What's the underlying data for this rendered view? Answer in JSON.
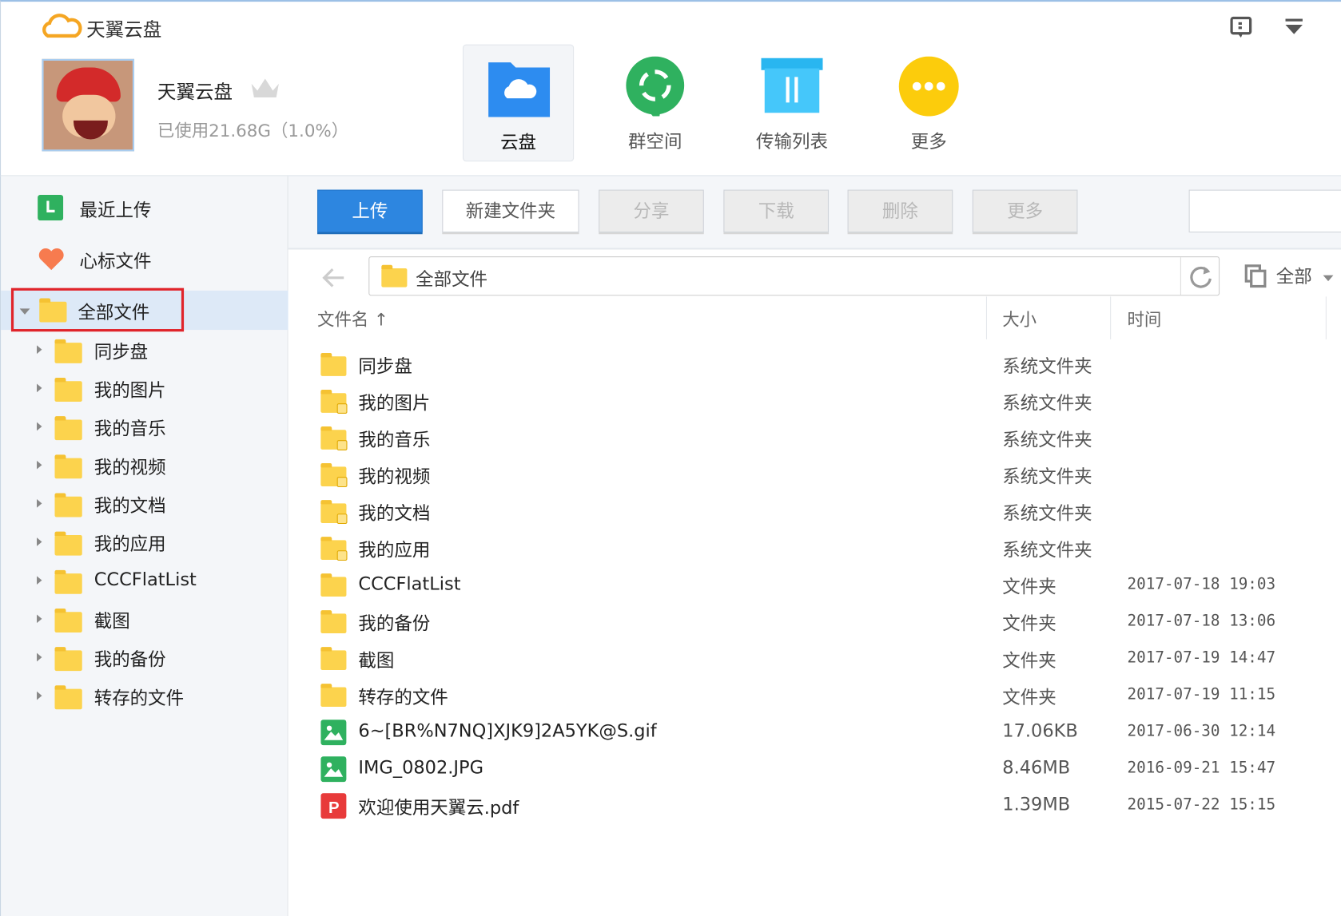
{
  "app": {
    "title": "天翼云盘"
  },
  "user": {
    "name": "天翼云盘",
    "usage": "已使用21.68G（1.0%）"
  },
  "nav": [
    {
      "label": "云盘",
      "icon": "cloud-drive-icon",
      "color": "#2d8cf0"
    },
    {
      "label": "群空间",
      "icon": "group-space-icon",
      "color": "#2fb15f"
    },
    {
      "label": "传输列表",
      "icon": "transfer-list-icon",
      "color": "#33c1f5"
    },
    {
      "label": "更多",
      "icon": "more-icon",
      "color": "#fccc0c"
    }
  ],
  "sidebar": {
    "recent": "最近上传",
    "favorites": "心标文件",
    "all_files": "全部文件",
    "tree": [
      "同步盘",
      "我的图片",
      "我的音乐",
      "我的视频",
      "我的文档",
      "我的应用",
      "CCCFlatList",
      "截图",
      "我的备份",
      "转存的文件"
    ]
  },
  "toolbar": {
    "upload": "上传",
    "new_folder": "新建文件夹",
    "share": "分享",
    "download": "下载",
    "delete": "删除",
    "more": "更多",
    "search_placeholder": ""
  },
  "path": {
    "current": "全部文件",
    "filter": "全部"
  },
  "columns": {
    "name": "文件名 ↑",
    "size": "大小",
    "time": "时间"
  },
  "files": [
    {
      "name": "同步盘",
      "size": "系统文件夹",
      "time": "",
      "type": "folder"
    },
    {
      "name": "我的图片",
      "size": "系统文件夹",
      "time": "",
      "type": "folder-image"
    },
    {
      "name": "我的音乐",
      "size": "系统文件夹",
      "time": "",
      "type": "folder-music"
    },
    {
      "name": "我的视频",
      "size": "系统文件夹",
      "time": "",
      "type": "folder-video"
    },
    {
      "name": "我的文档",
      "size": "系统文件夹",
      "time": "",
      "type": "folder-doc"
    },
    {
      "name": "我的应用",
      "size": "系统文件夹",
      "time": "",
      "type": "folder-app"
    },
    {
      "name": "CCCFlatList",
      "size": "文件夹",
      "time": "2017-07-18 19:03",
      "type": "folder"
    },
    {
      "name": "我的备份",
      "size": "文件夹",
      "time": "2017-07-18 13:06",
      "type": "folder"
    },
    {
      "name": "截图",
      "size": "文件夹",
      "time": "2017-07-19 14:47",
      "type": "folder"
    },
    {
      "name": "转存的文件",
      "size": "文件夹",
      "time": "2017-07-19 11:15",
      "type": "folder"
    },
    {
      "name": "6~[BR%N7NQ]XJK9]2A5YK@S.gif",
      "size": "17.06KB",
      "time": "2017-06-30 12:14",
      "type": "image"
    },
    {
      "name": "IMG_0802.JPG",
      "size": "8.46MB",
      "time": "2016-09-21 15:47",
      "type": "image"
    },
    {
      "name": "欢迎使用天翼云.pdf",
      "size": "1.39MB",
      "time": "2015-07-22 15:15",
      "type": "pdf"
    }
  ]
}
